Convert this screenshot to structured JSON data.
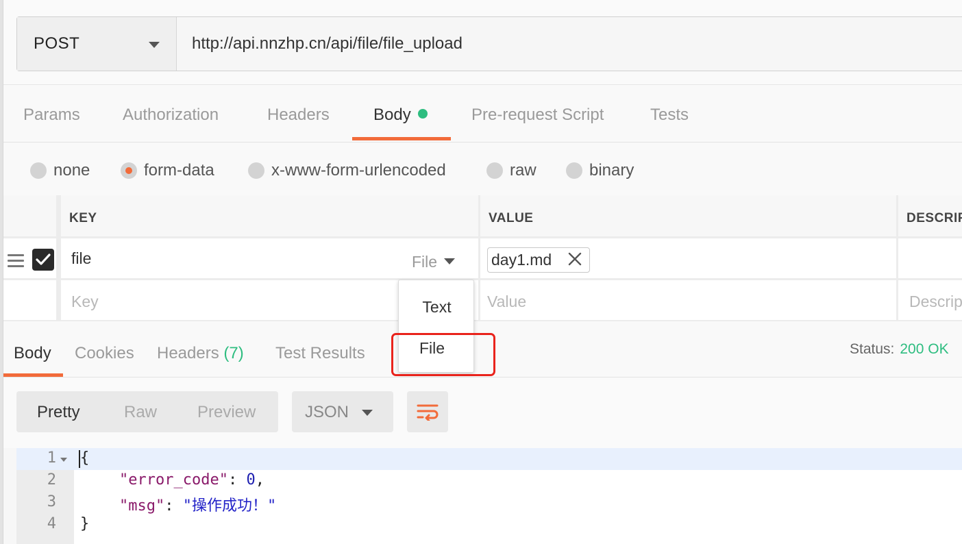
{
  "request": {
    "method": "POST",
    "url": "http://api.nnzhp.cn/api/file/file_upload"
  },
  "request_tabs": [
    {
      "label": "Params"
    },
    {
      "label": "Authorization"
    },
    {
      "label": "Headers"
    },
    {
      "label": "Body",
      "active": true,
      "indicator_color": "#2ebd80"
    },
    {
      "label": "Pre-request Script"
    },
    {
      "label": "Tests"
    }
  ],
  "body_types": {
    "options": [
      "none",
      "form-data",
      "x-www-form-urlencoded",
      "raw",
      "binary"
    ],
    "selected": "form-data"
  },
  "form_table": {
    "headers": {
      "key": "KEY",
      "value": "VALUE",
      "description": "DESCRIP"
    },
    "rows": [
      {
        "checked": true,
        "key": "file",
        "type": "File",
        "value": "day1.md"
      }
    ],
    "placeholders": {
      "key": "Key",
      "value": "Value",
      "description": "Descrip"
    }
  },
  "type_dropdown": {
    "options": [
      "Text",
      "File"
    ],
    "highlighted": "File"
  },
  "response": {
    "tabs": [
      {
        "label": "Body",
        "active": true
      },
      {
        "label": "Cookies"
      },
      {
        "label": "Headers",
        "count": "(7)"
      },
      {
        "label": "Test Results"
      }
    ],
    "status_label": "Status:",
    "status_value": "200 OK",
    "view_modes": [
      "Pretty",
      "Raw",
      "Preview"
    ],
    "active_view": "Pretty",
    "format": "JSON",
    "code": {
      "line_numbers": [
        "1",
        "2",
        "3",
        "4"
      ],
      "open_brace": "{",
      "close_brace": "}",
      "fields": [
        {
          "key": "\"error_code\"",
          "value": "0",
          "trail": ","
        },
        {
          "key": "\"msg\"",
          "value": "\"操作成功！\"",
          "trail": ""
        }
      ]
    }
  },
  "colors": {
    "accent": "#f26b3a",
    "success": "#2ebd80",
    "highlight": "#e9231c"
  },
  "icons": [
    "menu-icon",
    "check-icon",
    "close-icon",
    "wrap-icon",
    "chevron-down-icon"
  ]
}
